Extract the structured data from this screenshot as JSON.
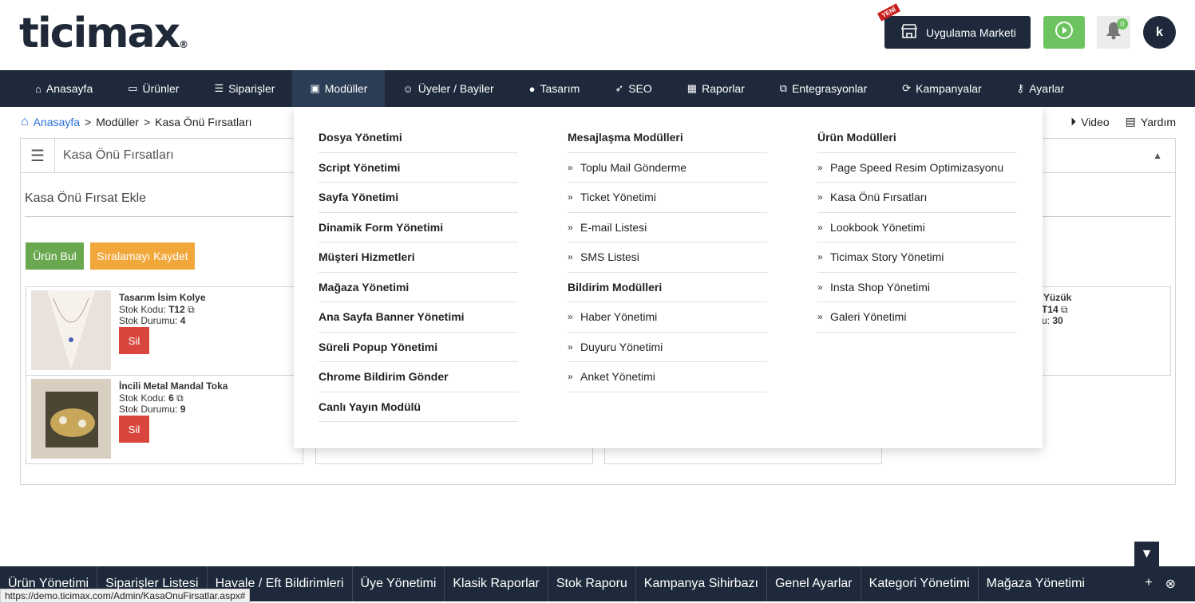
{
  "header": {
    "logo_text": "ticimax",
    "new_badge": "YENİ",
    "market_label": "Uygulama Marketi",
    "notification_count": "0",
    "avatar_letter": "k"
  },
  "nav": {
    "items": [
      {
        "label": "Anasayfa",
        "icon": "home-icon"
      },
      {
        "label": "Ürünler",
        "icon": "folder-icon"
      },
      {
        "label": "Siparişler",
        "icon": "list-icon"
      },
      {
        "label": "Modüller",
        "icon": "module-icon"
      },
      {
        "label": "Üyeler / Bayiler",
        "icon": "user-icon"
      },
      {
        "label": "Tasarım",
        "icon": "palette-icon"
      },
      {
        "label": "SEO",
        "icon": "rocket-icon"
      },
      {
        "label": "Raporlar",
        "icon": "chart-icon"
      },
      {
        "label": "Entegrasyonlar",
        "icon": "integration-icon"
      },
      {
        "label": "Kampanyalar",
        "icon": "refresh-icon"
      },
      {
        "label": "Ayarlar",
        "icon": "key-icon"
      }
    ],
    "active_index": 3
  },
  "breadcrumb": {
    "home": "Anasayfa",
    "level1": "Modüller",
    "level2": "Kasa Önü Fırsatları",
    "separator": ">"
  },
  "help": {
    "video": "Video",
    "help": "Yardım"
  },
  "panel": {
    "title": "Kasa Önü Fırsatları",
    "subtitle": "Kasa Önü Fırsat Ekle",
    "find_button": "Ürün Bul",
    "save_button": "Sıralamayı Kaydet"
  },
  "cards": [
    {
      "name": "Tasarım İsim Kolye",
      "code_label": "Stok Kodu:",
      "code": "T12",
      "stock_label": "Stok Durumu:",
      "stock": "4",
      "delete": "Sil"
    },
    {
      "name": "İncili Metal Mandal Toka",
      "code_label": "Stok Kodu:",
      "code": "6",
      "stock_label": "Stok Durumu:",
      "stock": "9",
      "delete": "Sil"
    },
    {
      "name_partial": "Yüzük",
      "code_partial": "T14",
      "stock_partial": "u:",
      "stock": "30"
    }
  ],
  "mega_menu": {
    "col1": [
      "Dosya Yönetimi",
      "Script Yönetimi",
      "Sayfa Yönetimi",
      "Dinamik Form Yönetimi",
      "Müşteri Hizmetleri",
      "Mağaza Yönetimi",
      "Ana Sayfa Banner Yönetimi",
      "Süreli Popup Yönetimi",
      "Chrome Bildirim Gönder",
      "Canlı Yayın Modülü"
    ],
    "col2_head": "Mesajlaşma Modülleri",
    "col2_items": [
      "Toplu Mail Gönderme",
      "Ticket Yönetimi",
      "E-mail Listesi",
      "SMS Listesi"
    ],
    "col2_head2": "Bildirim Modülleri",
    "col2_items2": [
      "Haber Yönetimi",
      "Duyuru Yönetimi",
      "Anket Yönetimi"
    ],
    "col3_head": "Ürün Modülleri",
    "col3_items": [
      "Page Speed Resim Optimizasyonu",
      "Kasa Önü Fırsatları",
      "Lookbook Yönetimi",
      "Ticimax Story Yönetimi",
      "Insta Shop Yönetimi",
      "Galeri Yönetimi"
    ]
  },
  "bottom_bar": {
    "items": [
      "Ürün Yönetimi",
      "Siparişler Listesi",
      "Havale / Eft Bildirimleri",
      "Üye Yönetimi",
      "Klasik Raporlar",
      "Stok Raporu",
      "Kampanya Sihirbazı",
      "Genel Ayarlar",
      "Kategori Yönetimi",
      "Mağaza Yönetimi"
    ]
  },
  "status_url": "https://demo.ticimax.com/Admin/KasaOnuFirsatlar.aspx#",
  "colors": {
    "navy": "#1e2a3b",
    "green": "#6aa84f",
    "orange": "#f1a73a",
    "red": "#d9463d",
    "link": "#2a6fdb"
  }
}
